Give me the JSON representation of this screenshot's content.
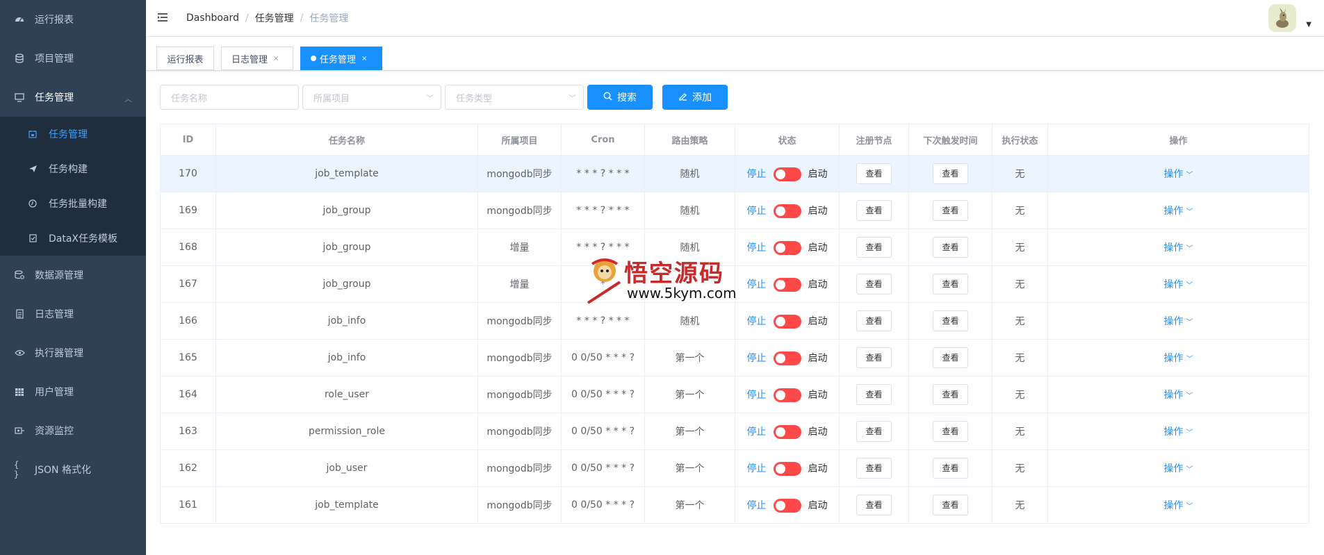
{
  "sidebar": {
    "items": [
      {
        "label": "运行报表",
        "icon": "dashboard-icon"
      },
      {
        "label": "项目管理",
        "icon": "database-icon"
      },
      {
        "label": "任务管理",
        "icon": "monitor-icon"
      },
      {
        "label": "数据源管理",
        "icon": "datasource-icon"
      },
      {
        "label": "日志管理",
        "icon": "document-icon"
      },
      {
        "label": "执行器管理",
        "icon": "eye-icon"
      },
      {
        "label": "用户管理",
        "icon": "grid-icon"
      },
      {
        "label": "资源监控",
        "icon": "monitor-link-icon"
      },
      {
        "label": "JSON 格式化",
        "icon": "braces-icon"
      }
    ],
    "sub_items": [
      {
        "label": "任务管理",
        "icon": "calendar-icon"
      },
      {
        "label": "任务构建",
        "icon": "send-icon"
      },
      {
        "label": "任务批量构建",
        "icon": "clock-icon"
      },
      {
        "label": "DataX任务模板",
        "icon": "checklist-icon"
      }
    ]
  },
  "navbar": {
    "breadcrumb": [
      "Dashboard",
      "任务管理",
      "任务管理"
    ],
    "separator": "/"
  },
  "tags": [
    {
      "label": "运行报表"
    },
    {
      "label": "日志管理",
      "close": "×"
    },
    {
      "label": "任务管理",
      "close": "×"
    }
  ],
  "filter": {
    "name_placeholder": "任务名称",
    "project_placeholder": "所属项目",
    "type_placeholder": "任务类型",
    "search_label": "搜索",
    "add_label": "添加"
  },
  "table": {
    "headers": [
      "ID",
      "任务名称",
      "所属项目",
      "Cron",
      "路由策略",
      "状态",
      "注册节点",
      "下次触发时间",
      "执行状态",
      "操作"
    ],
    "stop_label": "停止",
    "start_label": "启动",
    "view_label": "查看",
    "op_label": "操作",
    "rows": [
      {
        "id": "170",
        "name": "job_template",
        "project": "mongodb同步",
        "cron": "* * * ? * * *",
        "route": "随机",
        "exec": "无"
      },
      {
        "id": "169",
        "name": "job_group",
        "project": "mongodb同步",
        "cron": "* * * ? * * *",
        "route": "随机",
        "exec": "无"
      },
      {
        "id": "168",
        "name": "job_group",
        "project": "增量",
        "cron": "* * * ? * * *",
        "route": "随机",
        "exec": "无"
      },
      {
        "id": "167",
        "name": "job_group",
        "project": "增量",
        "cron": "*",
        "route": "",
        "exec": "无"
      },
      {
        "id": "166",
        "name": "job_info",
        "project": "mongodb同步",
        "cron": "* * * ? * * *",
        "route": "随机",
        "exec": "无"
      },
      {
        "id": "165",
        "name": "job_info",
        "project": "mongodb同步",
        "cron": "0 0/50 * * * ?",
        "route": "第一个",
        "exec": "无"
      },
      {
        "id": "164",
        "name": "role_user",
        "project": "mongodb同步",
        "cron": "0 0/50 * * * ?",
        "route": "第一个",
        "exec": "无"
      },
      {
        "id": "163",
        "name": "permission_role",
        "project": "mongodb同步",
        "cron": "0 0/50 * * * ?",
        "route": "第一个",
        "exec": "无"
      },
      {
        "id": "162",
        "name": "job_user",
        "project": "mongodb同步",
        "cron": "0 0/50 * * * ?",
        "route": "第一个",
        "exec": "无"
      },
      {
        "id": "161",
        "name": "job_template",
        "project": "mongodb同步",
        "cron": "0 0/50 * * * ?",
        "route": "第一个",
        "exec": "无"
      }
    ]
  },
  "watermark": {
    "title": "悟空源码",
    "url": "www.5kym.com"
  },
  "colors": {
    "sidebar_bg": "#304156",
    "submenu_bg": "#1f2d3d",
    "accent": "#1890ff",
    "switch_off": "#ff4949",
    "row_highlight": "#ecf5ff"
  }
}
